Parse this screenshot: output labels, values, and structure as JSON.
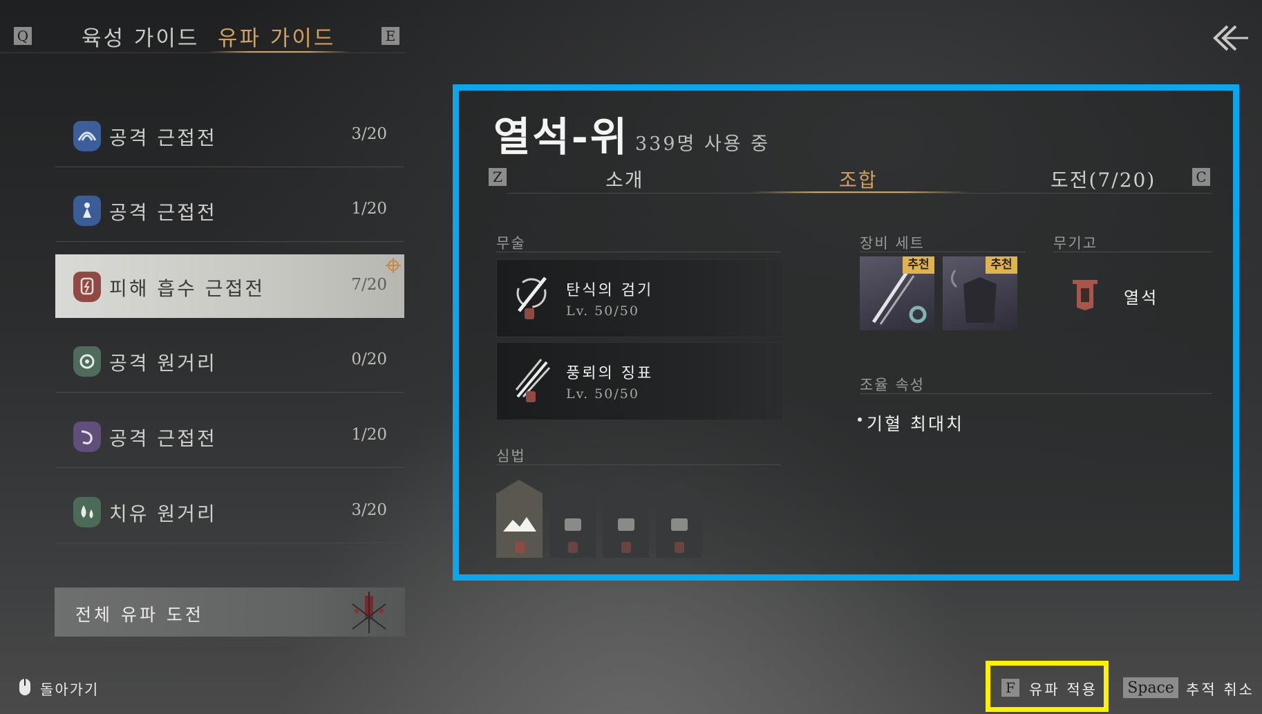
{
  "top_tabs": {
    "left_key": "Q",
    "right_key": "E",
    "tabs": [
      {
        "label": "육성 가이드",
        "active": false
      },
      {
        "label": "유파 가이드",
        "active": true
      }
    ]
  },
  "list": [
    {
      "label": "공격 근접전",
      "count": "3/20",
      "icon": "wave-emblem-icon",
      "color": "#3c5f9c",
      "selected": false
    },
    {
      "label": "공격 근접전",
      "count": "1/20",
      "icon": "figure-emblem-icon",
      "color": "#3a5d95",
      "selected": false
    },
    {
      "label": "피해 흡수 근접전",
      "count": "7/20",
      "icon": "shield-emblem-icon",
      "color": "#8f4a44",
      "selected": true
    },
    {
      "label": "공격 원거리",
      "count": "0/20",
      "icon": "spiral-emblem-icon",
      "color": "#4e6b5b",
      "selected": false
    },
    {
      "label": "공격 근접전",
      "count": "1/20",
      "icon": "swirl-emblem-icon",
      "color": "#5f4f7a",
      "selected": false
    },
    {
      "label": "치유 원거리",
      "count": "3/20",
      "icon": "drops-emblem-icon",
      "color": "#4b6a57",
      "selected": false
    }
  ],
  "all_challenge": "전체 유파 도전",
  "panel": {
    "title": "열석-위",
    "users": "339명 사용 중",
    "left_key": "Z",
    "right_key": "C",
    "tabs": [
      {
        "label": "소개",
        "active": false
      },
      {
        "label": "조합",
        "active": true
      },
      {
        "label": "도전(7/20)",
        "active": false
      }
    ],
    "martial_head": "무술",
    "skills": [
      {
        "name": "탄식의 검기",
        "level": "Lv. 50/50",
        "icon": "sword-skill-icon"
      },
      {
        "name": "풍뢰의 징표",
        "level": "Lv. 50/50",
        "icon": "spear-skill-icon"
      }
    ],
    "inner_head": "심법",
    "gear_head": "장비 세트",
    "recommend": "추천",
    "weapon_head": "무기고",
    "weapon_name": "열석",
    "attr_head": "조율 속성",
    "attr_item": "기혈 최대치"
  },
  "bottom": {
    "back": "돌아가기",
    "apply_key": "F",
    "apply": "유파 적용",
    "cancel_key": "Space",
    "cancel": "추적 취소"
  },
  "colors": {
    "accent_gold": "#d3a15a",
    "highlight_blue": "#0aa6ee",
    "highlight_yellow": "#fff200"
  }
}
